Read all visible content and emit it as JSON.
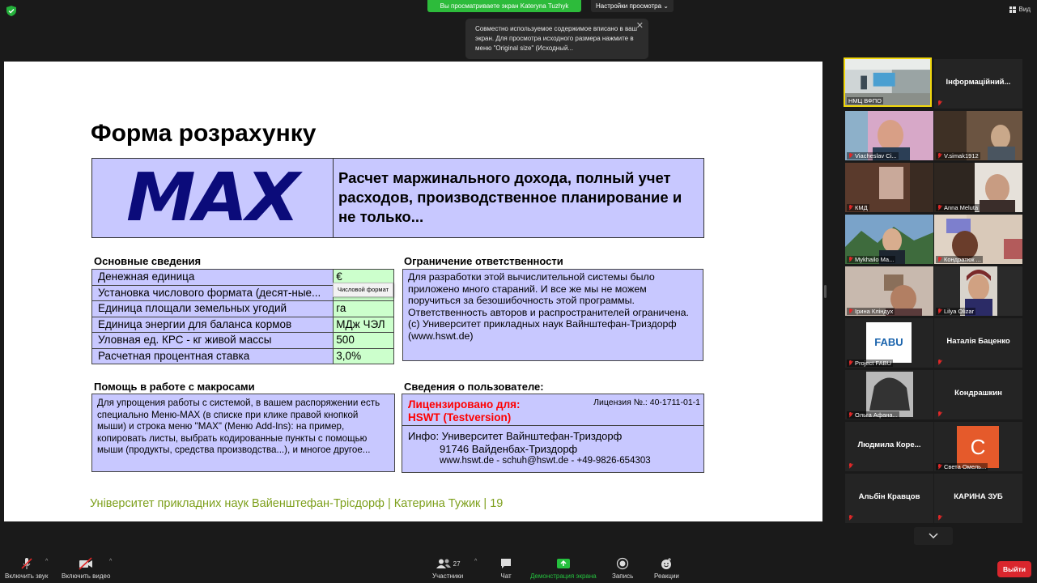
{
  "top": {
    "share_banner": "Вы просматриваете экран Kateryna Tuzhyk",
    "view_options": "Настройки просмотра",
    "view_button": "Вид",
    "tooltip_text": "Совместно используемое содержимое вписано в ваш экран. Для просмотра исходного размера нажмите в меню \"Original size\" (Исходный..."
  },
  "slide": {
    "title": "Форма розрахунку",
    "logo_text": "MAX",
    "headline": "Расчет маржинального дохода, полный учет расходов, производственное планирование и не только...",
    "basic_title": "Основные сведения",
    "basic_rows": [
      {
        "k": "Денежная единица",
        "v": "€"
      },
      {
        "k": "Установка числового формата (десят-ные...",
        "v": ""
      },
      {
        "k": "Единица площали земельных угодий",
        "v": "га"
      },
      {
        "k": "Единица энергии для баланса кормов",
        "v": "МДж ЧЭЛ"
      },
      {
        "k": "Уловная ед. КРС - кг живой массы",
        "v": "500"
      },
      {
        "k": "Расчетная процентная ставка",
        "v": "3,0%"
      }
    ],
    "hint": "Числовой формат",
    "disclaimer_title": "Ограничение ответственности",
    "disclaimer_text": "Для разработки этой вычислительной системы было приложено много стараний. И все же мы не можем поручиться за безошибочность этой программы. Ответственность авторов и распространителей ограничена. (с) Университет прикладных наук Вайнштефан-Триздорф (www.hswt.de)",
    "macros_title": "Помощь в работе с макросами",
    "macros_text": "Для упрощения работы с системой, в вашем распоряжении есть специально Меню-MAX (в списке при клике правой кнопкой мыши) и строка меню \"MAX\" (Меню Add-Ins): на пример, копировать листы, выбрать кодированные пункты с помощью мыши (продукты, средства производства...), и многое другое...",
    "user_title": "Сведения о пользователе:",
    "licensed_for": "Лицензировано для:",
    "licensee": "HSWT (Testversion)",
    "license_no": "Лицензия №.: 40-1711-01-1",
    "info_line1": "Инфо: Университет Вайнштефан-Триздорф",
    "info_line2": "91746 Вайденбах-Триздорф",
    "info_line3": "www.hswt.de  -  schuh@hswt.de  -  +49-9826-654303",
    "footer": "Університет прикладних наук Вайенштефан-Трісдорф | Катерина Тужик  |  19"
  },
  "participants": [
    {
      "name": "НМЦ ВФПО",
      "kind": "video"
    },
    {
      "name": "Інформаційний...",
      "kind": "name"
    },
    {
      "name": "Viacheslav Сі...",
      "kind": "video"
    },
    {
      "name": "V.simak1912",
      "kind": "video"
    },
    {
      "name": "КМД",
      "kind": "video"
    },
    {
      "name": "Anna Meluta",
      "kind": "video"
    },
    {
      "name": "Mykhailo Ma...",
      "kind": "video"
    },
    {
      "name": "Кондратюк ...",
      "kind": "video"
    },
    {
      "name": "Ірина Кліндух",
      "kind": "video"
    },
    {
      "name": "Lilya Olizar",
      "kind": "video"
    },
    {
      "name": "Project FABU",
      "kind": "logo",
      "logo": "FABU"
    },
    {
      "name": "Наталія Баценко",
      "kind": "name"
    },
    {
      "name": "Ольга Афана...",
      "kind": "video"
    },
    {
      "name": "Кондрашкин",
      "kind": "name"
    },
    {
      "name": "Людмила  Коре...",
      "kind": "name"
    },
    {
      "name": "Света Омель...",
      "kind": "avatar",
      "initial": "С"
    },
    {
      "name": "Альбін Кравцов",
      "kind": "name"
    },
    {
      "name": "КАРИНА ЗУБ",
      "kind": "name"
    }
  ],
  "toolbar": {
    "mute": "Включить звук",
    "video": "Включить видео",
    "participants": "Участники",
    "participants_count": "27",
    "chat": "Чат",
    "share": "Демонстрация экрана",
    "record": "Запись",
    "reactions": "Реакции",
    "leave": "Выйти"
  }
}
